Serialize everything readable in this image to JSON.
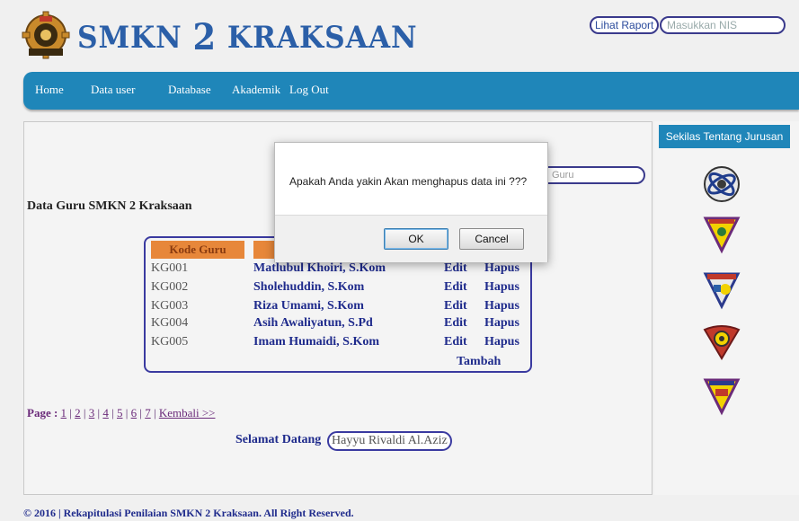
{
  "header": {
    "brand": "SMKN",
    "brand_num": "2",
    "brand_rest": "KRAKSAAN",
    "lihat_raport": "Lihat Raport",
    "nis_placeholder": "Masukkan NIS"
  },
  "nav": {
    "items": [
      "Home",
      "Data user",
      "Database",
      "Akademik",
      "Log Out"
    ]
  },
  "sidebar": {
    "title": "Sekilas Tentang Jurusan",
    "logos": [
      "tkj-logo-icon",
      "jurusan-shield-1-icon",
      "jurusan-shield-2-icon",
      "mesin-shield-icon",
      "tata-busana-shield-icon"
    ]
  },
  "search": {
    "placeholder_tail": "Guru"
  },
  "main": {
    "title": "Data Guru SMKN 2 Kraksaan",
    "table": {
      "header_kode": "Kode Guru",
      "rows": [
        {
          "kode": "KG001",
          "nama": "Matlubul Khoiri, S.Kom",
          "edit": "Edit",
          "hapus": "Hapus"
        },
        {
          "kode": "KG002",
          "nama": "Sholehuddin, S.Kom",
          "edit": "Edit",
          "hapus": "Hapus"
        },
        {
          "kode": "KG003",
          "nama": "Riza Umami, S.Kom",
          "edit": "Edit",
          "hapus": "Hapus"
        },
        {
          "kode": "KG004",
          "nama": "Asih Awaliyatun, S.Pd",
          "edit": "Edit",
          "hapus": "Hapus"
        },
        {
          "kode": "KG005",
          "nama": "Imam Humaidi, S.Kom",
          "edit": "Edit",
          "hapus": "Hapus"
        }
      ],
      "tambah": "Tambah"
    },
    "pager": {
      "label": "Page :",
      "pages": [
        "1",
        "2",
        "3",
        "4",
        "5",
        "6",
        "7"
      ],
      "back": "Kembali >>"
    },
    "welcome": "Selamat Datang",
    "user": "Hayyu Rivaldi Al.Aziz"
  },
  "footer": "© 2016 | Rekapitulasi Penilaian SMKN 2 Kraksaan. All Right Reserved.",
  "dialog": {
    "message": "Apakah Anda yakin Akan menghapus data ini ???",
    "ok": "OK",
    "cancel": "Cancel"
  },
  "colors": {
    "nav": "#1f86b9",
    "brand": "#2b5fa8",
    "table_header": "#e7873a",
    "link": "#1f2b8c"
  }
}
